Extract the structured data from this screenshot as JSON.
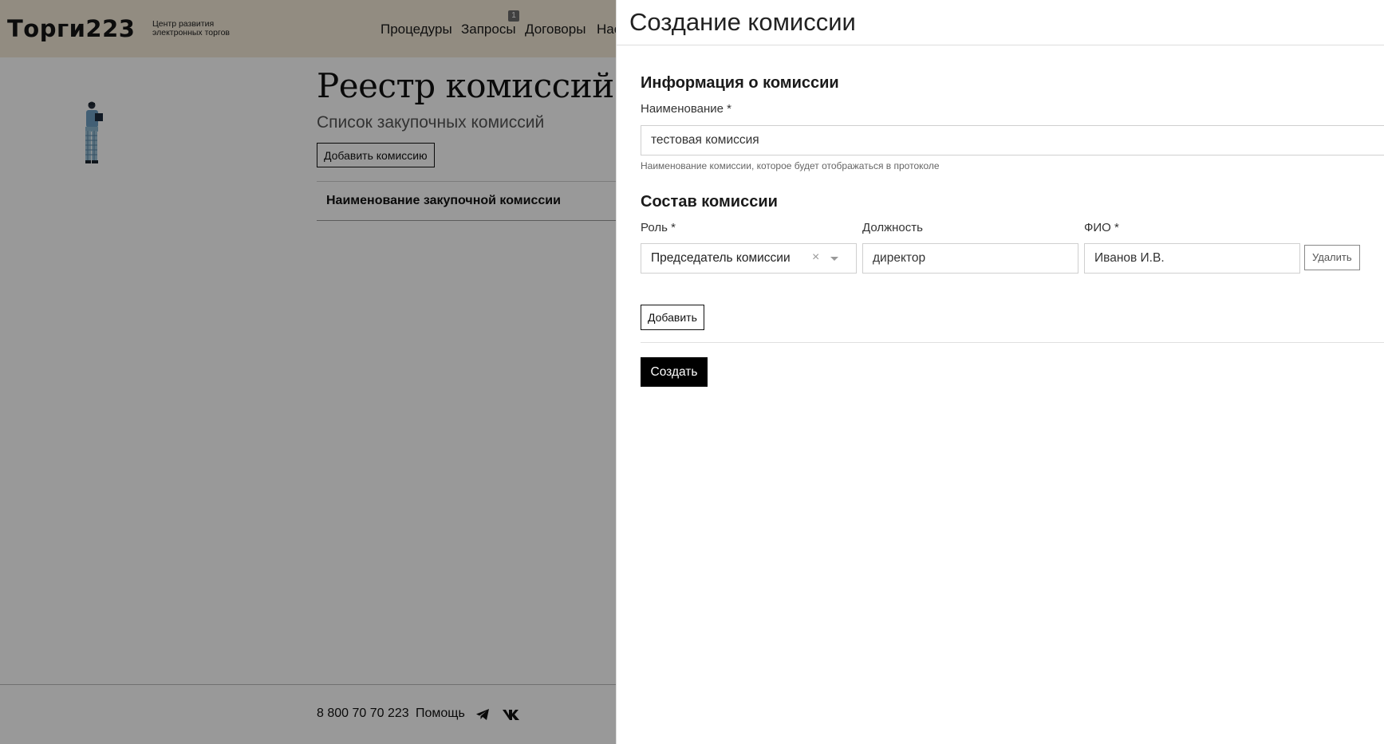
{
  "header": {
    "logo": "Торги223",
    "logo_sub_line1": "Центр развития",
    "logo_sub_line2": "электронных торгов",
    "nav": {
      "procedures": "Процедуры",
      "requests": "Запросы",
      "requests_badge": "1",
      "contracts": "Договоры",
      "settings_partial": "Нас"
    }
  },
  "registry": {
    "title": "Реестр комиссий",
    "subtitle": "Список закупочных комиссий",
    "add_button": "Добавить комиссию",
    "table_header": "Наименование закупочной комиссии"
  },
  "footer": {
    "phone": "8 800 70 70 223",
    "help": "Помощь",
    "icons": [
      "telegram-icon",
      "vk-icon"
    ]
  },
  "panel": {
    "title": "Создание комиссии",
    "info_section": {
      "title": "Информация о комиссии",
      "name_label": "Наименование *",
      "name_value": "тестовая комиссия",
      "name_hint": "Наименование комиссии, которое будет отображаться в протоколе"
    },
    "members_section": {
      "title": "Состав комиссии",
      "role_label": "Роль *",
      "position_label": "Должность",
      "fio_label": "ФИО *",
      "rows": [
        {
          "role": "Председатель комиссии",
          "position": "директор",
          "fio": "Иванов И.В.",
          "delete_label": "Удалить"
        }
      ],
      "add_label": "Добавить"
    },
    "create_label": "Создать"
  },
  "colors": {
    "header_bg": "#f3ead8",
    "overlay": "rgba(0,0,0,0.4)",
    "primary_button": "#000000"
  }
}
